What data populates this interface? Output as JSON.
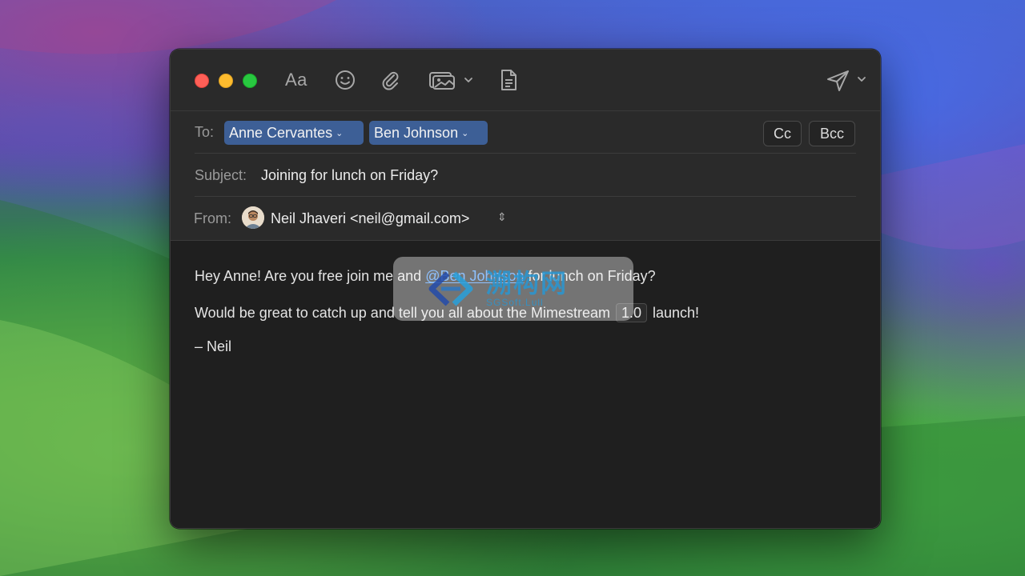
{
  "toolbar": {
    "font_label": "Aa",
    "icons": [
      "emoji-icon",
      "paperclip-icon",
      "photo-icon",
      "document-icon",
      "send-icon"
    ]
  },
  "to": {
    "label": "To:",
    "recipients": [
      "Anne Cervantes",
      "Ben Johnson"
    ],
    "cc_label": "Cc",
    "bcc_label": "Bcc"
  },
  "subject": {
    "label": "Subject:",
    "value": "Joining for lunch on Friday?"
  },
  "from": {
    "label": "From:",
    "value": "Neil Jhaveri <neil@gmail.com>"
  },
  "body": {
    "line1_before": "Hey Anne! Are you free join me and ",
    "mention": "@Ben Johnson",
    "line1_after": " for lunch on Friday?",
    "line2_before": "Would be great to catch up and tell you all about the Mimestream ",
    "version": "1.0",
    "line2_after": " launch!",
    "signature": "– Neil"
  },
  "watermark": {
    "title": "溯构网",
    "subtitle": "SGSoft.Lull"
  },
  "colors": {
    "chip_bg": "#3d5f96",
    "mention": "#4a9cff",
    "window_bg": "#1f1f1f",
    "header_bg": "#2a2a2a"
  }
}
